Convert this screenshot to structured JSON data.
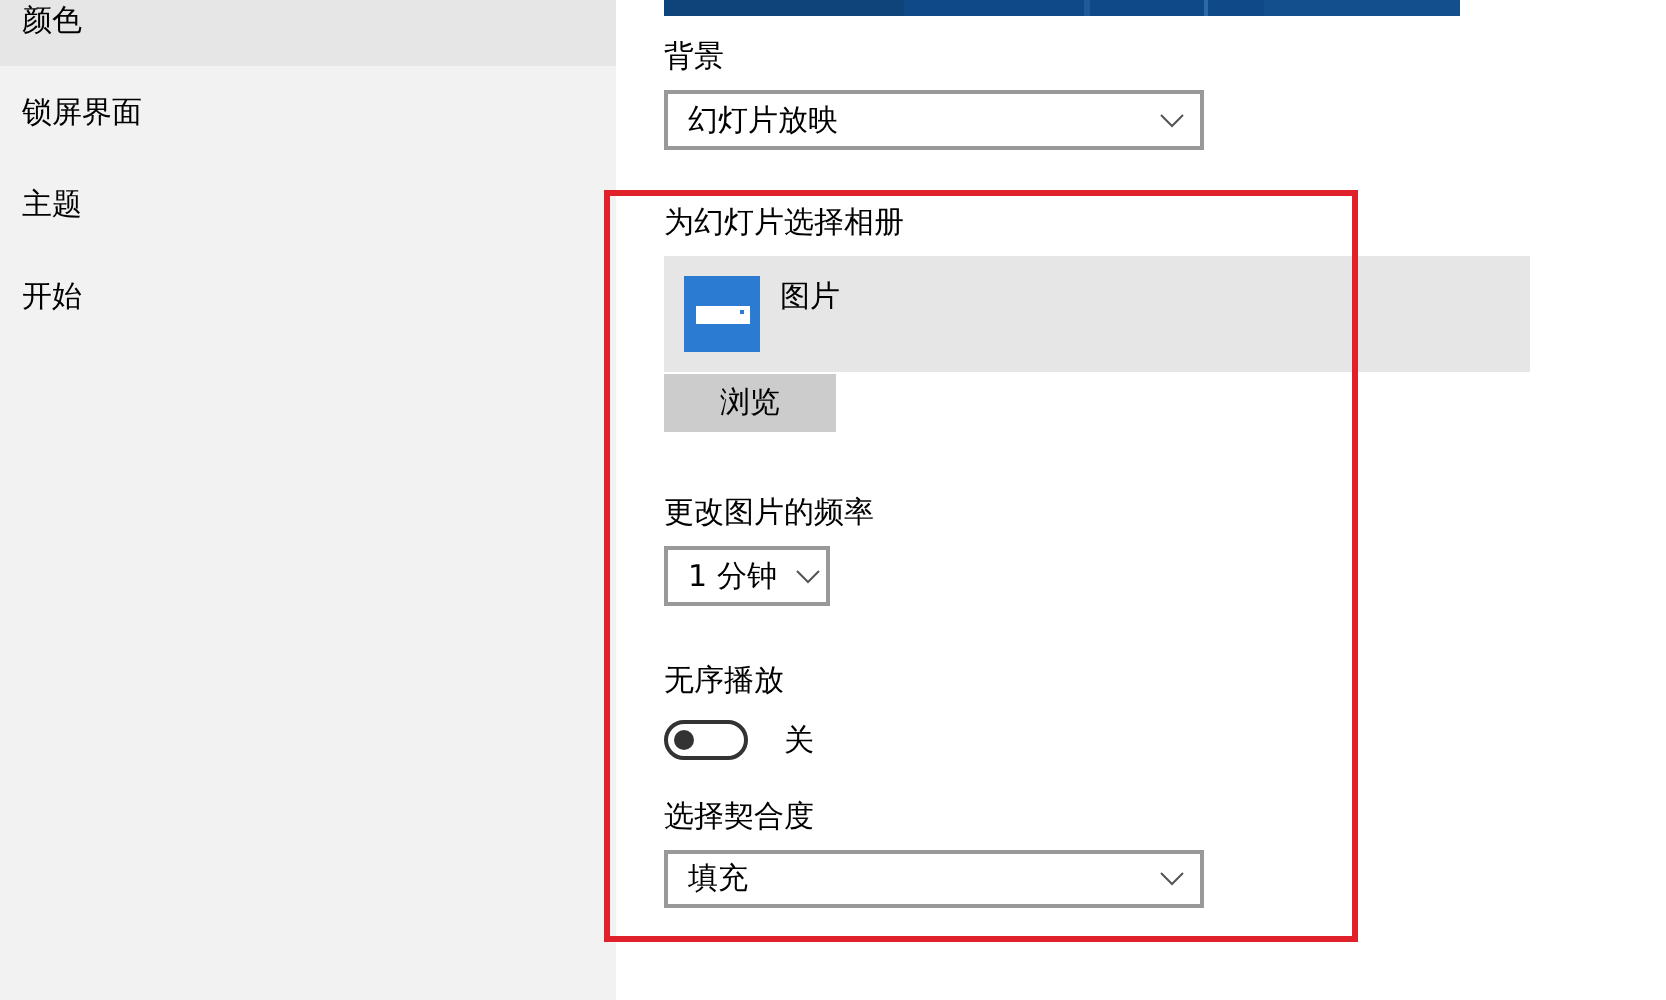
{
  "sidebar": {
    "items": [
      {
        "label": "颜色",
        "selected": true
      },
      {
        "label": "锁屏界面",
        "selected": false
      },
      {
        "label": "主题",
        "selected": false
      },
      {
        "label": "开始",
        "selected": false
      }
    ]
  },
  "background": {
    "label": "背景",
    "value": "幻灯片放映"
  },
  "album": {
    "label": "为幻灯片选择相册",
    "folder": "图片",
    "browse": "浏览"
  },
  "frequency": {
    "label": "更改图片的频率",
    "value": "1 分钟"
  },
  "shuffle": {
    "label": "无序播放",
    "on": false,
    "state_text": "关"
  },
  "fit": {
    "label": "选择契合度",
    "value": "填充"
  }
}
